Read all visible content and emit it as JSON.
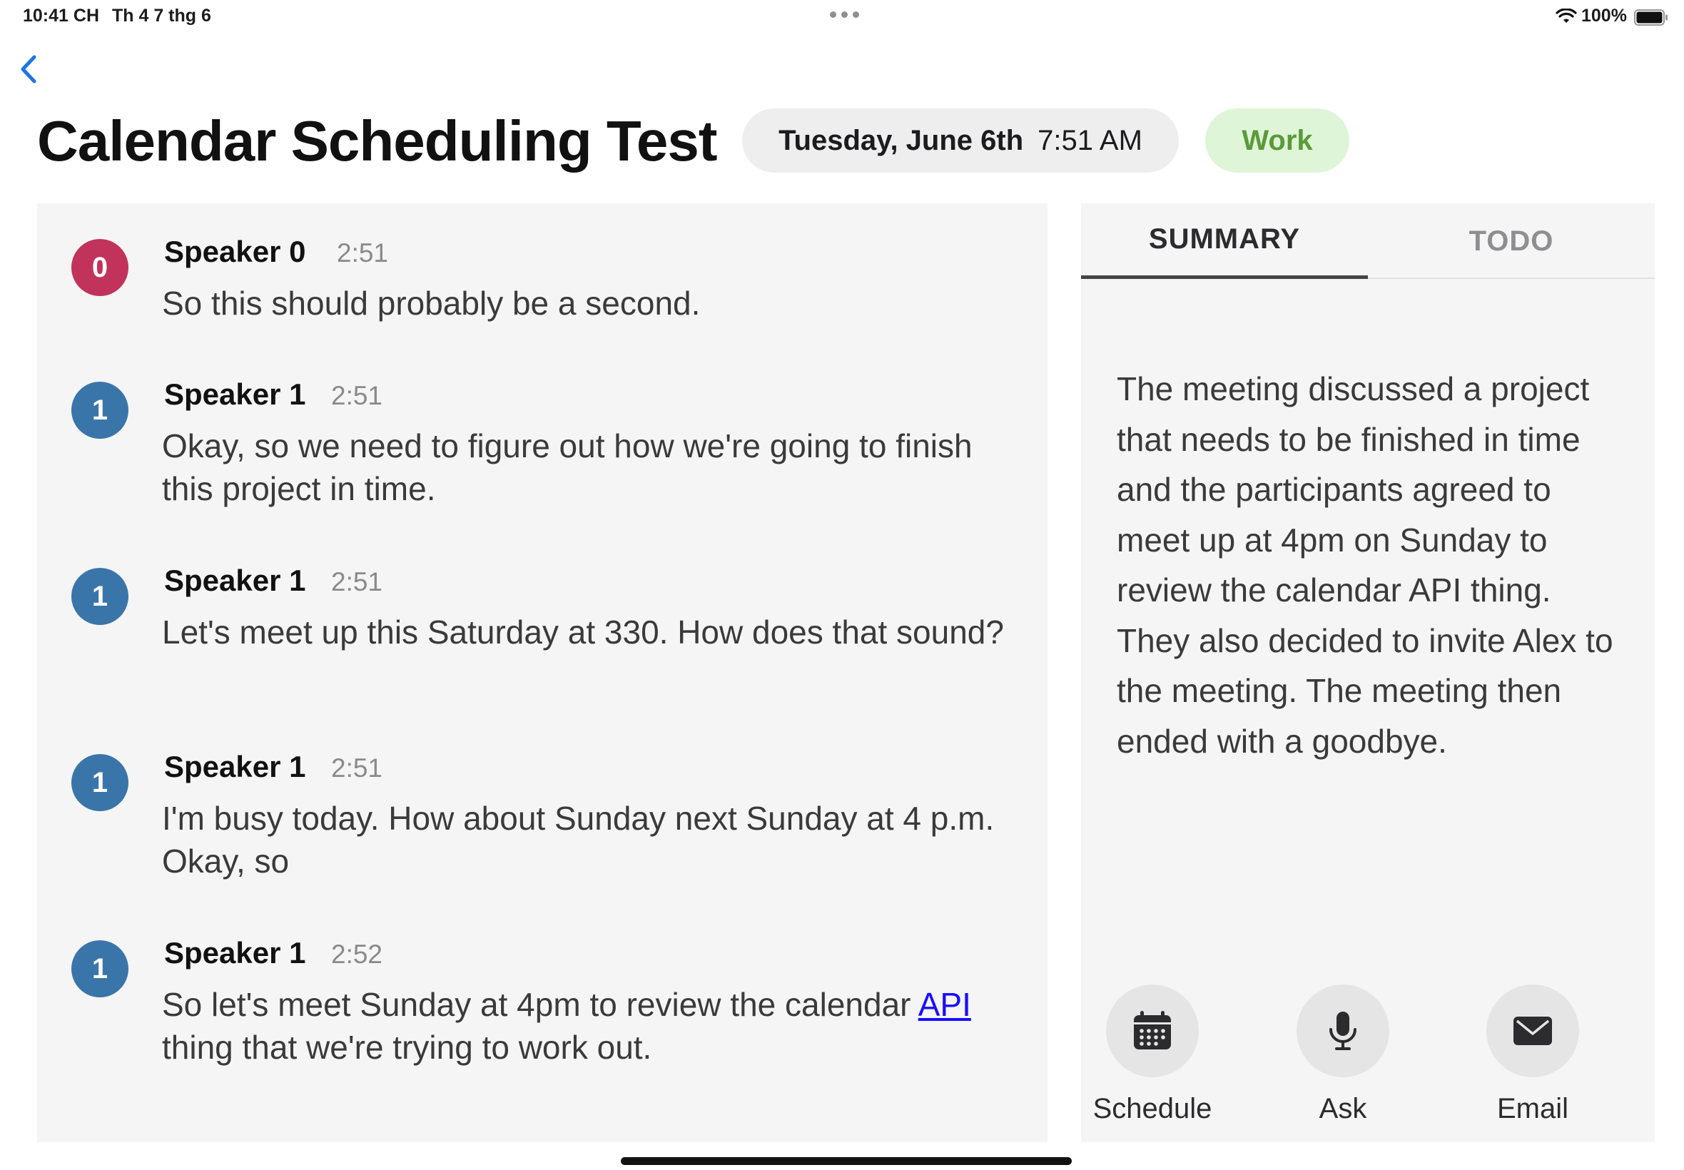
{
  "status_bar": {
    "time": "10:41 CH",
    "date": "Th 4 7 thg 6",
    "battery": "100%"
  },
  "header": {
    "title": "Calendar Scheduling Test",
    "date": "Tuesday, June 6th",
    "time": "7:51 AM",
    "tag": "Work",
    "tag_bg": "#dff5d8",
    "tag_color": "#5a9a3a"
  },
  "transcript": [
    {
      "avatar": "0",
      "color": "#c1335a",
      "speaker": "Speaker 0",
      "timestamp": "2:51",
      "text": "So this should probably be a second."
    },
    {
      "avatar": "1",
      "color": "#3a75aa",
      "speaker": "Speaker 1",
      "timestamp": "2:51",
      "text": "Okay, so we need to figure out how we're going to finish this project in time."
    },
    {
      "avatar": "1",
      "color": "#3a75aa",
      "speaker": "Speaker 1",
      "timestamp": "2:51",
      "text": "Let's meet up this Saturday at 330. How does that sound?"
    },
    {
      "avatar": "1",
      "color": "#3a75aa",
      "speaker": "Speaker 1",
      "timestamp": "2:51",
      "text": "I'm busy today. How about Sunday next Sunday at 4 p.m. Okay, so"
    },
    {
      "avatar": "1",
      "color": "#3a75aa",
      "speaker": "Speaker 1",
      "timestamp": "2:52",
      "text_before": "So let's meet Sunday at 4pm to review the calendar ",
      "link": "API",
      "text_after": " thing that we're trying to work out."
    }
  ],
  "panel": {
    "tabs": [
      "SUMMARY",
      "TODO"
    ],
    "active_tab": "SUMMARY",
    "summary": "The meeting discussed a project that needs to be finished in time and the participants agreed to meet up at 4pm on Sunday to review the calendar API thing. They also decided to invite Alex to the meeting. The meeting then ended with a goodbye.",
    "actions": [
      {
        "label": "Schedule",
        "icon": "calendar-icon"
      },
      {
        "label": "Ask",
        "icon": "microphone-icon"
      },
      {
        "label": "Email",
        "icon": "envelope-icon"
      }
    ]
  }
}
